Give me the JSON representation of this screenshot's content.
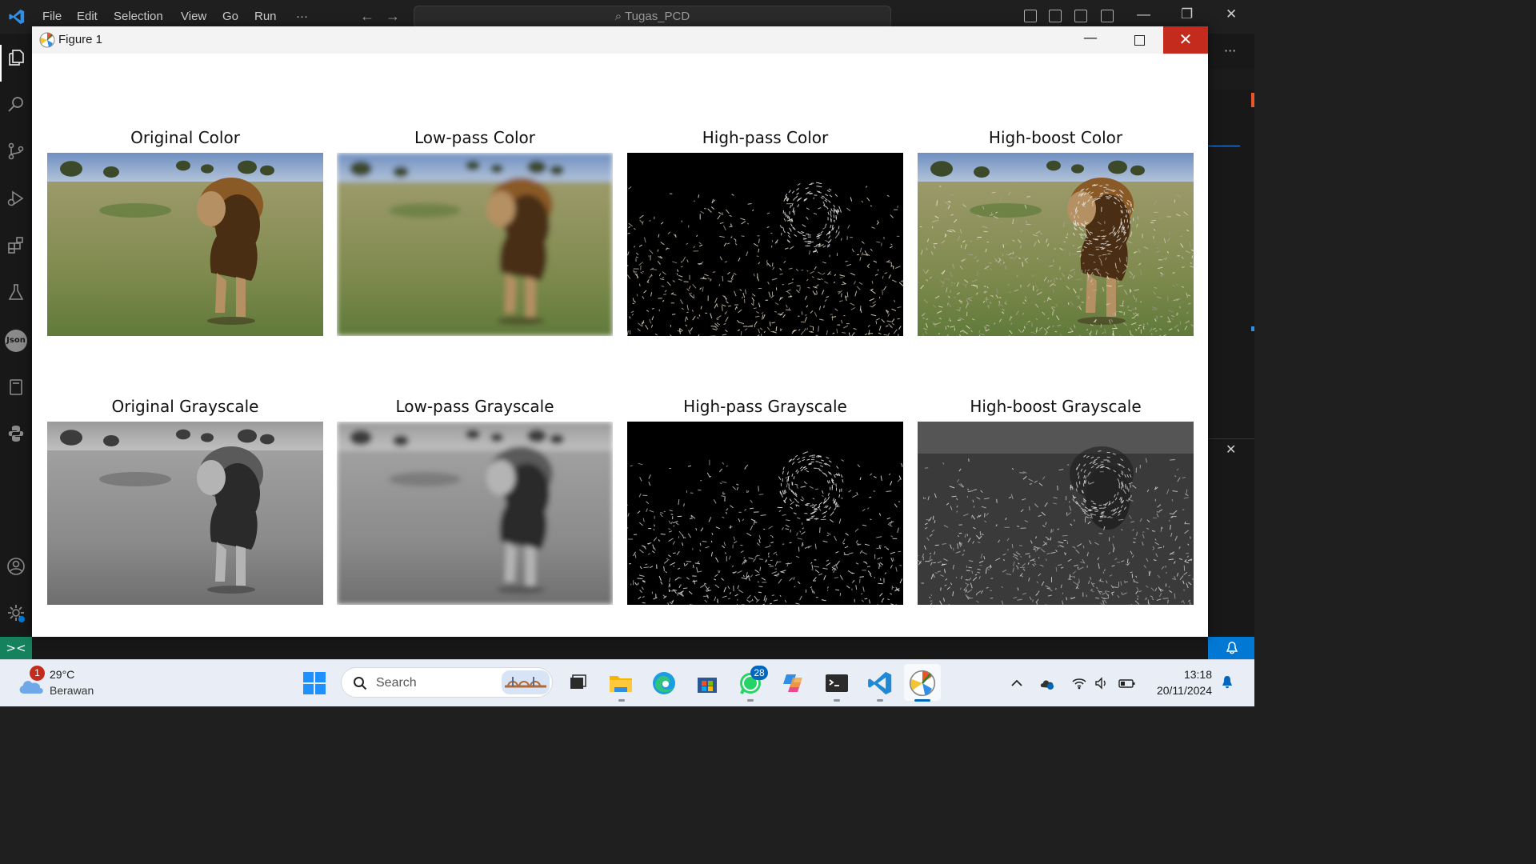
{
  "vscode": {
    "menu": [
      "File",
      "Edit",
      "Selection",
      "View",
      "Go",
      "Run",
      "···"
    ],
    "search_text": "Tugas_PCD",
    "activity_icons": [
      "explorer-icon",
      "search-icon",
      "source-control-icon",
      "run-debug-icon",
      "extensions-icon",
      "testing-icon",
      "json-icon",
      "notebook-icon",
      "python-icon",
      "account-icon",
      "settings-icon"
    ],
    "json_label": "Json",
    "remote_label": "><"
  },
  "figure": {
    "window_title": "Figure 1",
    "minimize_glyph": "—",
    "close_glyph": "✕",
    "panels": [
      {
        "title": "Original Color",
        "mode": "color",
        "filter": "original"
      },
      {
        "title": "Low-pass Color",
        "mode": "color",
        "filter": "lowpass"
      },
      {
        "title": "High-pass Color",
        "mode": "color",
        "filter": "highpass"
      },
      {
        "title": "High-boost Color",
        "mode": "color",
        "filter": "highboost"
      },
      {
        "title": "Original Grayscale",
        "mode": "gray",
        "filter": "original"
      },
      {
        "title": "Low-pass Grayscale",
        "mode": "gray",
        "filter": "lowpass"
      },
      {
        "title": "High-pass Grayscale",
        "mode": "gray",
        "filter": "highpass"
      },
      {
        "title": "High-boost Grayscale",
        "mode": "gray",
        "filter": "highboost"
      }
    ]
  },
  "taskbar": {
    "weather_badge": "1",
    "weather_temp": "29°C",
    "weather_desc": "Berawan",
    "search_placeholder": "Search",
    "whatsapp_badge": "28",
    "clock_time": "13:18",
    "clock_date": "20/11/2024"
  }
}
